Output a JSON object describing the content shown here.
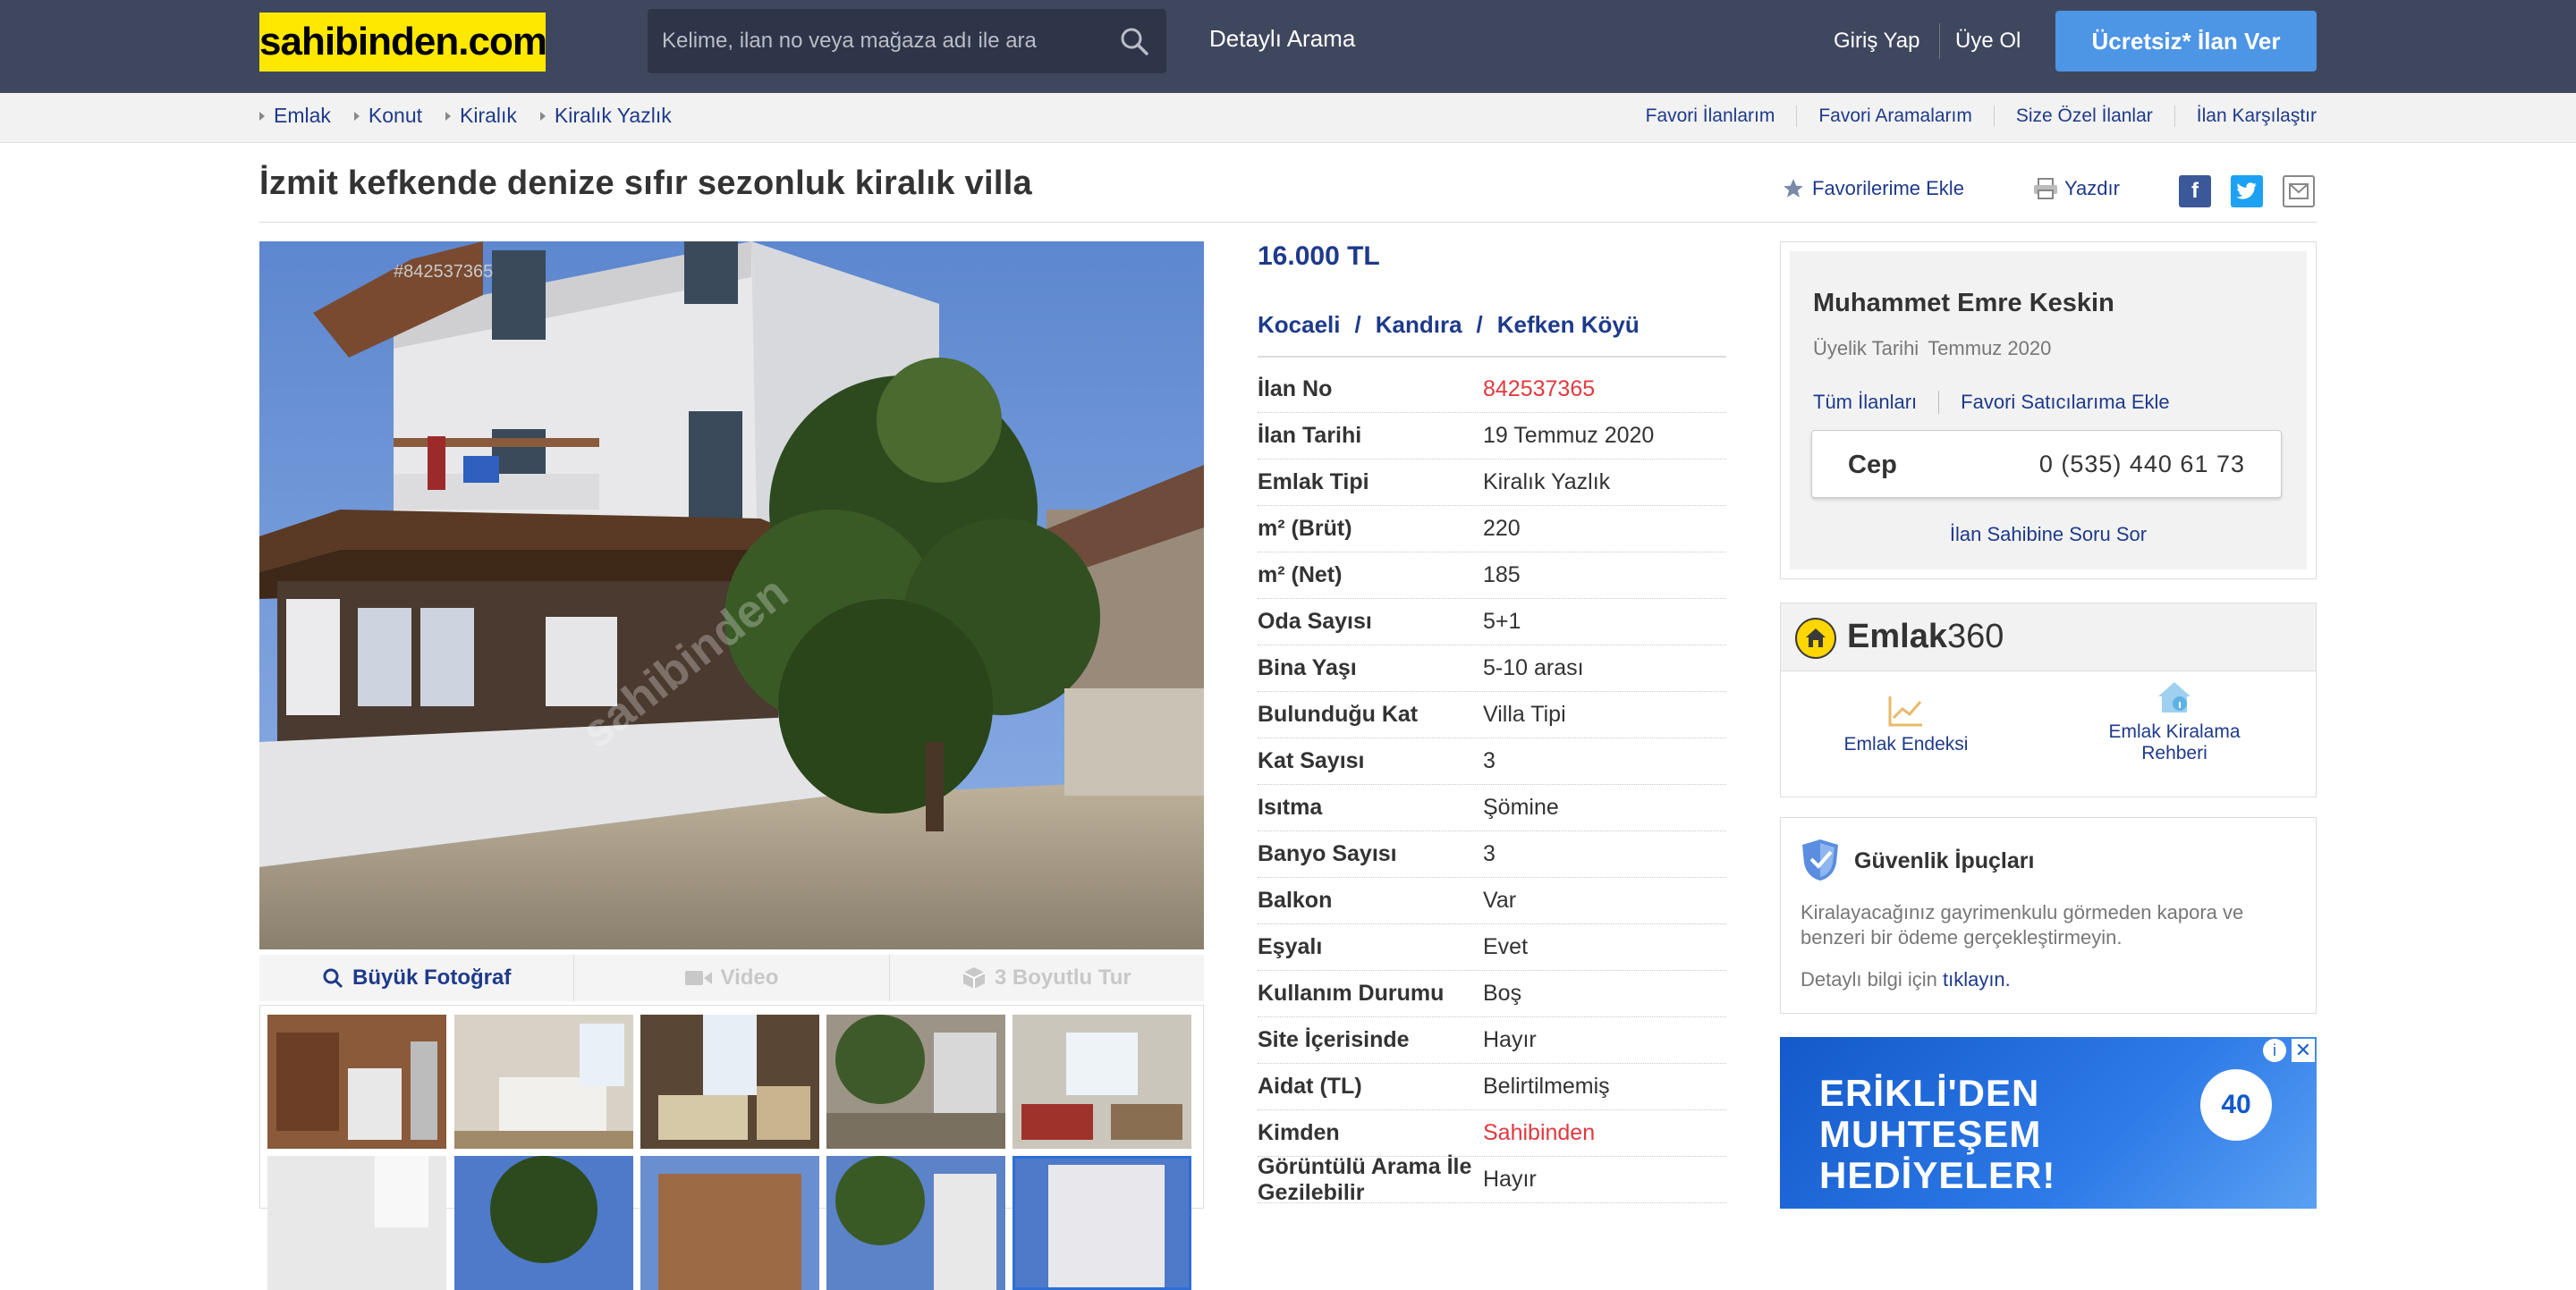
{
  "header": {
    "logo_text": "sahibinden.com",
    "search_placeholder": "Kelime, ilan no veya mağaza adı ile ara",
    "detailed_search": "Detaylı Arama",
    "login": "Giriş Yap",
    "register": "Üye Ol",
    "post_ad": "Ücretsiz* İlan Ver"
  },
  "breadcrumb": [
    "Emlak",
    "Konut",
    "Kiralık",
    "Kiralık Yazlık"
  ],
  "top_links": [
    "Favori İlanlarım",
    "Favori Aramalarım",
    "Size Özel İlanlar",
    "İlan Karşılaştır"
  ],
  "listing": {
    "title": "İzmit kefkende denize sıfır sezonluk kiralık villa",
    "add_favorite": "Favorilerime Ekle",
    "print": "Yazdır",
    "price": "16.000 TL",
    "location": [
      "Kocaeli",
      "Kandıra",
      "Kefken Köyü"
    ],
    "location_sep": "/",
    "photo_watermark": "#842537365",
    "photo_logo": "sahibinden",
    "photo_tabs": [
      "Büyük Fotoğraf",
      "Video",
      "3 Boyutlu Tur"
    ],
    "specs": [
      {
        "k": "İlan No",
        "v": "842537365",
        "red": true
      },
      {
        "k": "İlan Tarihi",
        "v": "19 Temmuz 2020"
      },
      {
        "k": "Emlak Tipi",
        "v": "Kiralık Yazlık"
      },
      {
        "k": "m² (Brüt)",
        "v": "220"
      },
      {
        "k": "m² (Net)",
        "v": "185"
      },
      {
        "k": "Oda Sayısı",
        "v": "5+1"
      },
      {
        "k": "Bina Yaşı",
        "v": "5-10 arası"
      },
      {
        "k": "Bulunduğu Kat",
        "v": "Villa Tipi"
      },
      {
        "k": "Kat Sayısı",
        "v": "3"
      },
      {
        "k": "Isıtma",
        "v": "Şömine"
      },
      {
        "k": "Banyo Sayısı",
        "v": "3"
      },
      {
        "k": "Balkon",
        "v": "Var"
      },
      {
        "k": "Eşyalı",
        "v": "Evet"
      },
      {
        "k": "Kullanım Durumu",
        "v": "Boş"
      },
      {
        "k": "Site İçerisinde",
        "v": "Hayır"
      },
      {
        "k": "Aidat (TL)",
        "v": "Belirtilmemiş"
      },
      {
        "k": "Kimden",
        "v": "Sahibinden",
        "red": true
      },
      {
        "k": "Görüntülü Arama İle Gezilebilir",
        "v": "Hayır"
      }
    ]
  },
  "seller": {
    "name": "Muhammet Emre Keskin",
    "since_label": "Üyelik Tarihi",
    "since_value": "Temmuz 2020",
    "all_listings": "Tüm İlanları",
    "add_fav_seller": "Favori Satıcılarıma Ekle",
    "phone_label": "Cep",
    "phone": "0 (535) 440 61 73",
    "ask": "İlan Sahibine Soru Sor"
  },
  "emlak360": {
    "title_bold": "Emlak",
    "title_light": "360",
    "items": [
      "Emlak Endeksi",
      "Emlak Kiralama Rehberi"
    ]
  },
  "security": {
    "title": "Güvenlik İpuçları",
    "text": "Kiralayacağınız gayrimenkulu görmeden kapora ve benzeri bir ödeme gerçekleştirmeyin.",
    "more_prefix": "Detaylı bilgi için",
    "more_link": "tıklayın."
  },
  "ad": {
    "lines": [
      "ERİKLİ'DEN",
      "MUHTEŞEM",
      "HEDİYELER!"
    ],
    "badge": "40"
  },
  "colors": {
    "header_bg": "#3f475f",
    "logo_bg": "#ffe800",
    "link_blue": "#1e3a8a",
    "accent_red": "#e0393e",
    "cta_blue": "#4d95e5"
  }
}
